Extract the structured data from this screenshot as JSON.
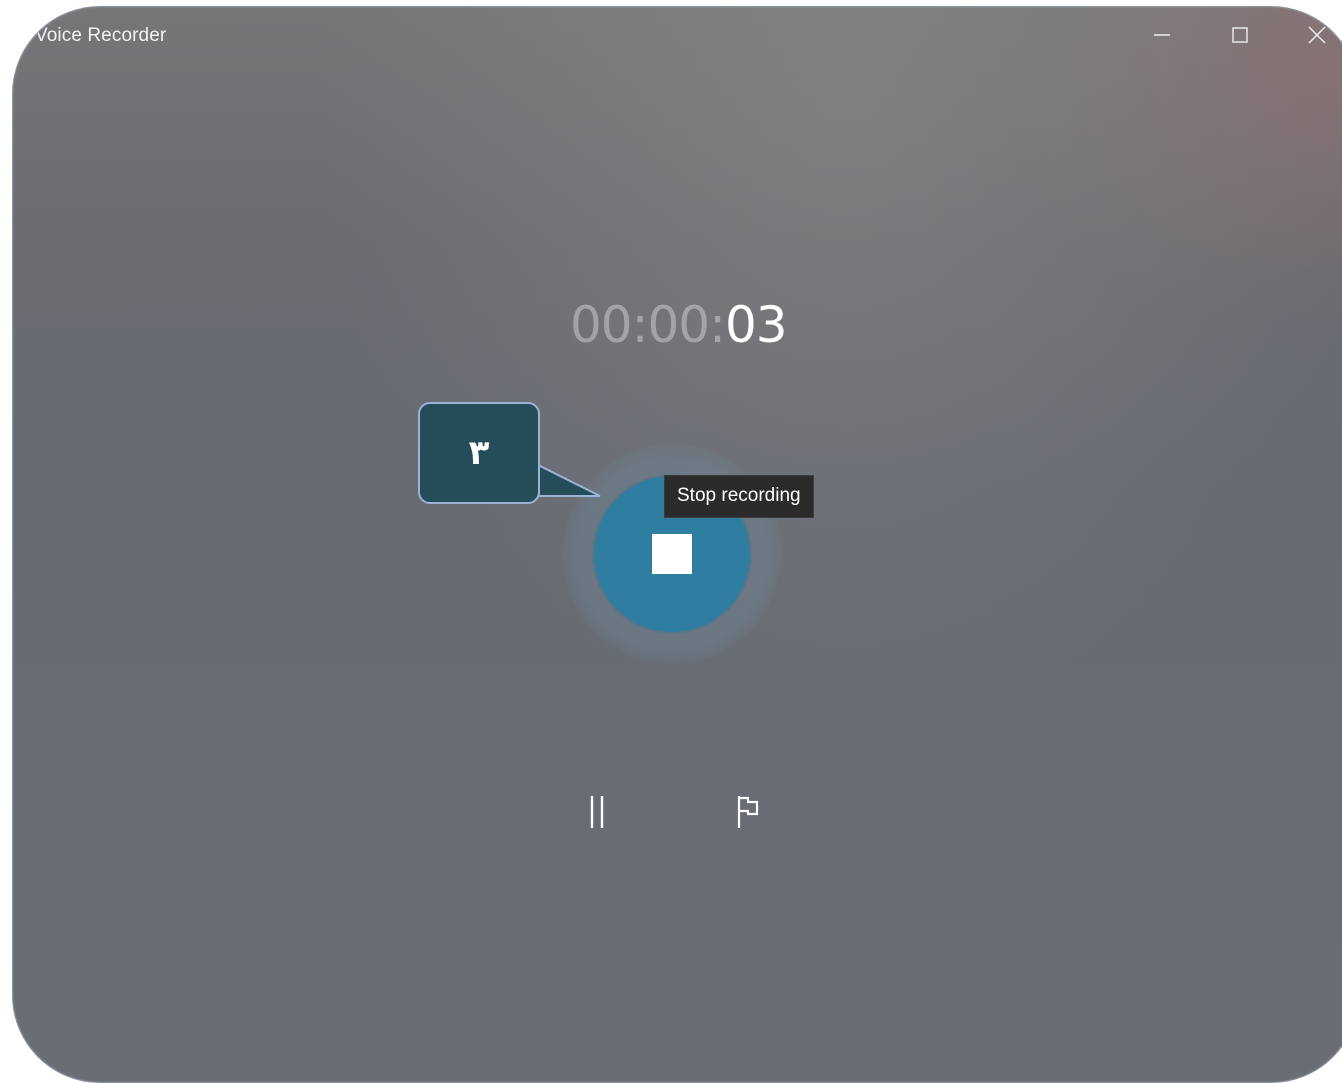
{
  "window": {
    "title": "Voice Recorder"
  },
  "caption_buttons": {
    "minimize_icon": "minimize-icon",
    "maximize_icon": "maximize-icon",
    "close_icon": "close-icon"
  },
  "timer": {
    "dim_part": "00:00:",
    "bright_part": "03"
  },
  "record": {
    "stop_icon": "stop-icon",
    "tooltip": "Stop recording",
    "button_color": "#2f7ea1"
  },
  "callout": {
    "label": "٣",
    "background": "#244d59",
    "border_color": "#9bb3d4"
  },
  "controls": {
    "pause_icon": "pause-icon",
    "flag_icon": "flag-icon"
  }
}
